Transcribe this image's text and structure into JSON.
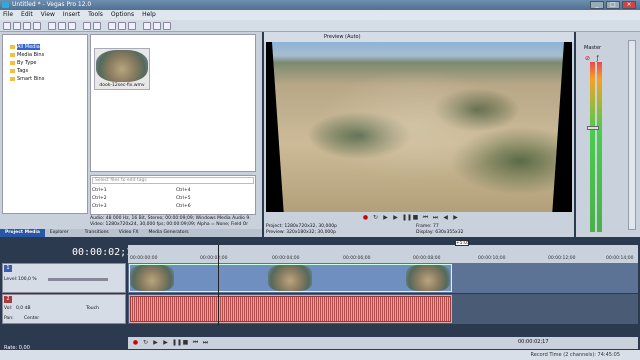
{
  "window": {
    "title": "Untitled * - Vegas Pro 12.0"
  },
  "menu": [
    "File",
    "Edit",
    "View",
    "Insert",
    "Tools",
    "Options",
    "Help"
  ],
  "project_media": {
    "tree": [
      "All Media",
      "Media Bins",
      "By Type",
      "Tags",
      "Smart Bins"
    ],
    "media_file": "dook-12sec-fix.wmv",
    "tag_search_placeholder": "Select files to edit tags",
    "shortcuts": [
      "Ctrl+1",
      "Ctrl+2",
      "Ctrl+3",
      "Ctrl+4",
      "Ctrl+5",
      "Ctrl+6"
    ],
    "info": [
      "Audio: 48 000 Hz, 16 Bit, Stereo; 00:00:09;09; Windows Media Audio 9.",
      "Video: 1280x720x24, 30,000 fps; 00:00:09;09; Alpha = None; Field Or"
    ]
  },
  "left_tabs": [
    "Project Media",
    "Explorer",
    "Transitions",
    "Video FX",
    "Media Generators"
  ],
  "preview": {
    "mode": "Preview (Auto)",
    "project_label": "Project:",
    "project_value": "1280x720x32, 30,000p",
    "preview_label": "Preview:",
    "preview_value": "320x180x32; 30,000p",
    "frame_label": "Frame:",
    "frame_value": "77",
    "display_label": "Display:",
    "display_value": "630x355x32"
  },
  "mixer": {
    "title": "Master"
  },
  "timeline": {
    "timecode": "00:00:02;17",
    "ruler_ticks": [
      "00:00:00:00",
      "00:00:02;00",
      "00:00:04;00",
      "00:00:06;00",
      "00:00:08;00",
      "00:00:10;00",
      "00:00:12;00",
      "00:00:14;00"
    ],
    "marker": "+5:05",
    "video_track": {
      "number": "1",
      "level_label": "Level:",
      "level_value": "100,0 %"
    },
    "audio_track": {
      "number": "2",
      "vol_label": "Vol:",
      "vol_value": "0,0 dB",
      "pan_label": "Pan:",
      "pan_value": "Center",
      "touch": "Touch"
    }
  },
  "status": {
    "rate": "Rate: 0,00",
    "record_time": "Record Time (2 channels): 74:45:05",
    "position": "00:00:02;17"
  }
}
